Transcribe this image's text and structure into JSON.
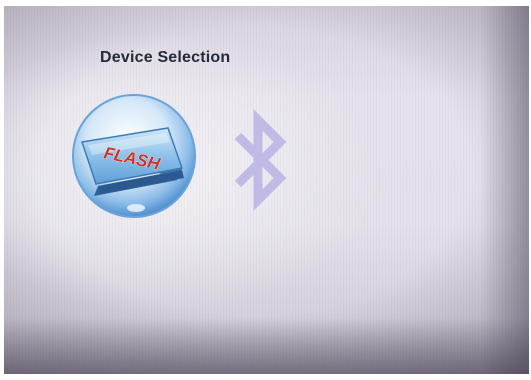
{
  "screen": {
    "title": "Device Selection"
  },
  "devices": [
    {
      "id": "flash",
      "label": "FLASH",
      "icon": "usb-flash-drive-icon",
      "selected": true
    },
    {
      "id": "bluetooth",
      "label": "",
      "icon": "bluetooth-icon",
      "selected": false
    }
  ],
  "colors": {
    "title_text": "#262a38",
    "selection_ring": "#5f9bd6",
    "flash_key_face": "#7fb7e6",
    "flash_label": "#c8322a",
    "bluetooth_glyph": "#b9b5e3"
  }
}
